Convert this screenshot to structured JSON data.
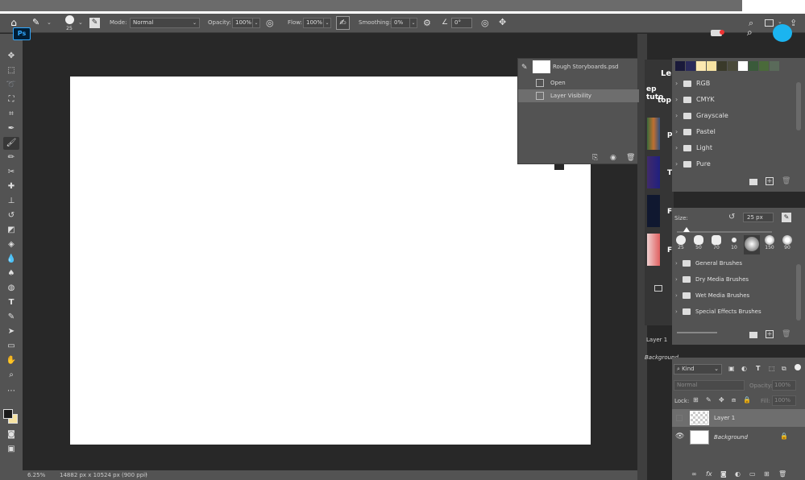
{
  "app": {
    "logo": "Ps"
  },
  "options": {
    "brush_size": "25",
    "mode_label": "Mode:",
    "mode_value": "Normal",
    "opacity_label": "Opacity:",
    "opacity_value": "100%",
    "flow_label": "Flow:",
    "flow_value": "100%",
    "smoothing_label": "Smoothing:",
    "smoothing_value": "0%",
    "angle_value": "0°"
  },
  "history": {
    "doc_name": "Rough Storyboards.psd",
    "items": [
      "Open",
      "Layer Visibility"
    ]
  },
  "learn": {
    "title": "Le",
    "line1": "ep tuto",
    "line2": "top",
    "thumb_labels": [
      "p",
      "T",
      "F",
      "F"
    ]
  },
  "swatch_groups": [
    "RGB",
    "CMYK",
    "Grayscale",
    "Pastel",
    "Light",
    "Pure"
  ],
  "swatch_colors": [
    "#1a1a3a",
    "#2a2a5a",
    "#fce8b0",
    "#f6e3a2",
    "#3a3a2a",
    "#4a4a3a",
    "#ffffff",
    "#3a5a3a",
    "#4a6a3a",
    "#5a6a5a"
  ],
  "brushes": {
    "size_label": "Size:",
    "size_value": "25 px",
    "tips": [
      "25",
      "50",
      "70",
      "10",
      "",
      "150",
      "90"
    ],
    "groups": [
      "General Brushes",
      "Dry Media Brushes",
      "Wet Media Brushes",
      "Special Effects Brushes"
    ]
  },
  "layers": {
    "filter_label": "Kind",
    "blend_mode": "Normal",
    "opacity_label": "Opacity:",
    "opacity_value": "100%",
    "lock_label": "Lock:",
    "fill_label": "Fill:",
    "fill_value": "100%",
    "layer1_name": "Layer 1",
    "bg_name": "Background",
    "partial_layer": "Layer 1",
    "partial_bg": "Background"
  },
  "status": {
    "zoom": "6.25%",
    "dimensions": "14882 px x 10524 px (900 ppi)"
  }
}
